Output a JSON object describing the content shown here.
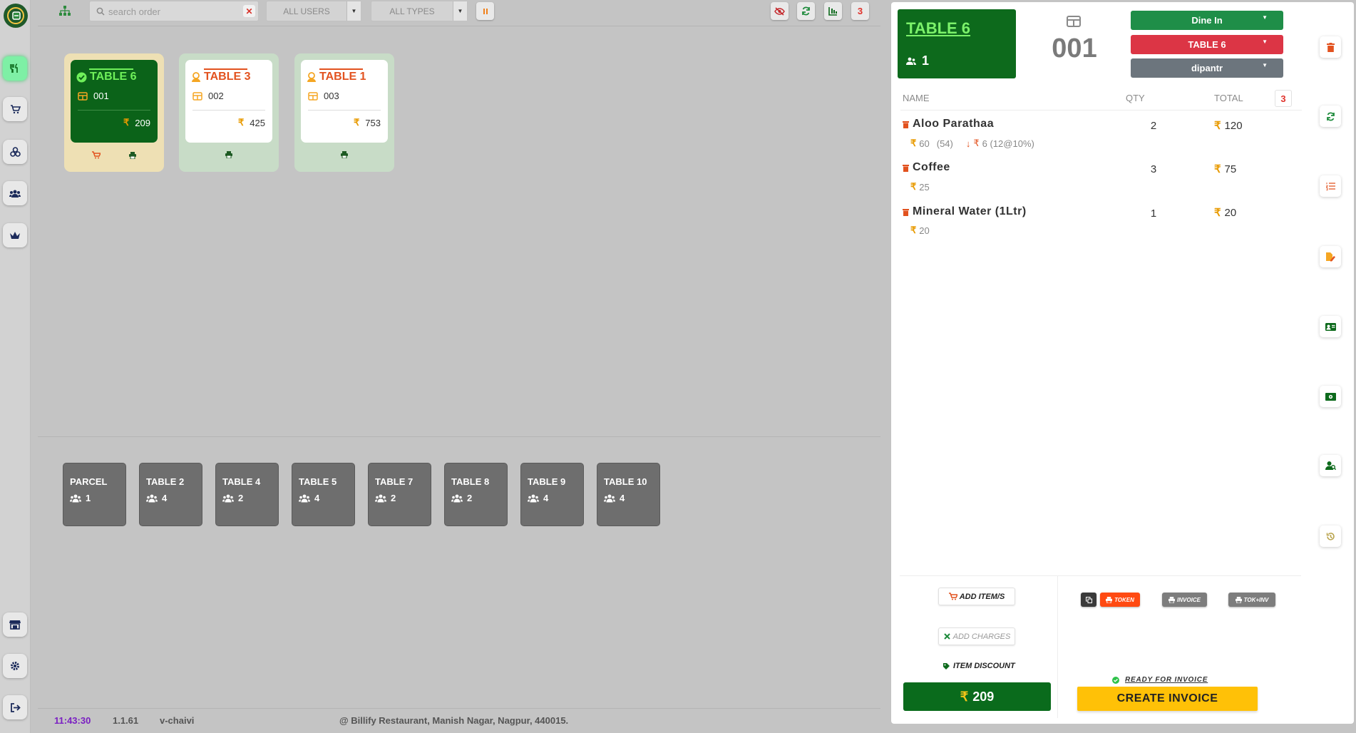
{
  "app": {
    "accent": "#0d6a1c",
    "sidebar_icons": [
      "restaurant-logo",
      "utensils-icon",
      "cart-icon",
      "coins-icon",
      "users-icon",
      "crown-icon",
      "store-icon",
      "gear-icon",
      "logout-icon"
    ]
  },
  "topbar": {
    "search_placeholder": "search order",
    "users_filter": "ALL USERS",
    "types_filter": "ALL TYPES",
    "badge_count": "3"
  },
  "orders": [
    {
      "table": "TABLE 6",
      "order_no": "001",
      "amount": "209",
      "status": "active"
    },
    {
      "table": "TABLE 3",
      "order_no": "002",
      "amount": "425",
      "status": "waiting"
    },
    {
      "table": "TABLE 1",
      "order_no": "003",
      "amount": "753",
      "status": "waiting"
    }
  ],
  "empty_tables": [
    {
      "name": "PARCEL",
      "people": "1"
    },
    {
      "name": "TABLE 2",
      "people": "4"
    },
    {
      "name": "TABLE 4",
      "people": "2"
    },
    {
      "name": "TABLE 5",
      "people": "4"
    },
    {
      "name": "TABLE 7",
      "people": "2"
    },
    {
      "name": "TABLE 8",
      "people": "2"
    },
    {
      "name": "TABLE 9",
      "people": "4"
    },
    {
      "name": "TABLE 10",
      "people": "4"
    }
  ],
  "footer": {
    "time": "11:43:30",
    "version": "1.1.61",
    "user": "v-chaivi",
    "address": "@ Billify Restaurant, Manish Nagar, Nagpur, 440015."
  },
  "panel": {
    "table": "TABLE 6",
    "people": "1",
    "order_no": "001",
    "order_type": "Dine In",
    "table_select": "TABLE 6",
    "waiter": "dipantr",
    "headers": {
      "name": "NAME",
      "qty": "QTY",
      "total": "TOTAL"
    },
    "item_count": "3",
    "items": [
      {
        "name": "Aloo Parathaa",
        "price": "60",
        "extra": "(54)",
        "discount": "6 (12@10%)",
        "qty": "2",
        "total": "120"
      },
      {
        "name": "Coffee",
        "price": "25",
        "qty": "3",
        "total": "75"
      },
      {
        "name": "Mineral Water (1Ltr)",
        "price": "20",
        "qty": "1",
        "total": "20"
      }
    ],
    "add_items": "ADD ITEM/S",
    "add_charges": "ADD CHARGES",
    "item_discount": "ITEM DISCOUNT",
    "print_token": "TOKEN",
    "print_invoice": "INVOICE",
    "print_tokinv": "TOK+INV",
    "ready_label": "READY FOR INVOICE",
    "grand_total": "209",
    "create_invoice": "CREATE INVOICE"
  }
}
